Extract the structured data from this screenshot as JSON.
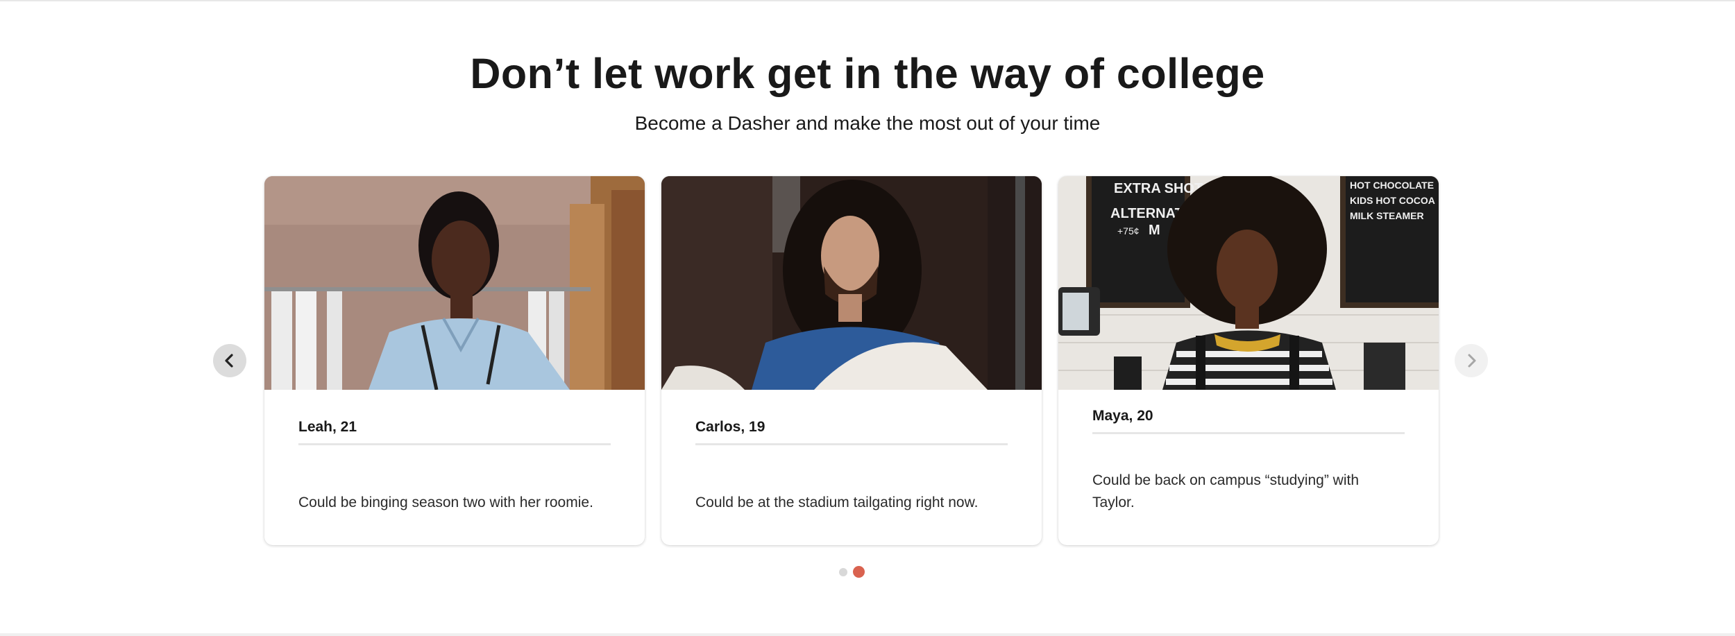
{
  "headline": "Don’t let work get in the way of college",
  "subheadline": "Become a Dasher and make the most out of your time",
  "cards": [
    {
      "name": "Leah, 21",
      "quote": "Could be binging season two with her roomie."
    },
    {
      "name": "Carlos, 19",
      "quote": "Could be at the stadium tailgating right now."
    },
    {
      "name": "Maya, 20",
      "quote": "Could be back on campus “studying” with Taylor."
    }
  ],
  "photo3_signs": {
    "left_board": [
      "EXTRA SHOT",
      "ALTERNATI",
      "+75¢",
      "M"
    ],
    "right_board": [
      "HOT CHOCOLATE",
      "KIDS HOT COCOA",
      "MILK STEAMER"
    ]
  },
  "carousel": {
    "prev_icon": "chevron-left-icon",
    "next_icon": "chevron-right-icon",
    "page_count": 2,
    "active_page": 2
  },
  "colors": {
    "accent": "#d9624f",
    "dot_inactive": "#d8d8d8",
    "text": "#191919"
  }
}
